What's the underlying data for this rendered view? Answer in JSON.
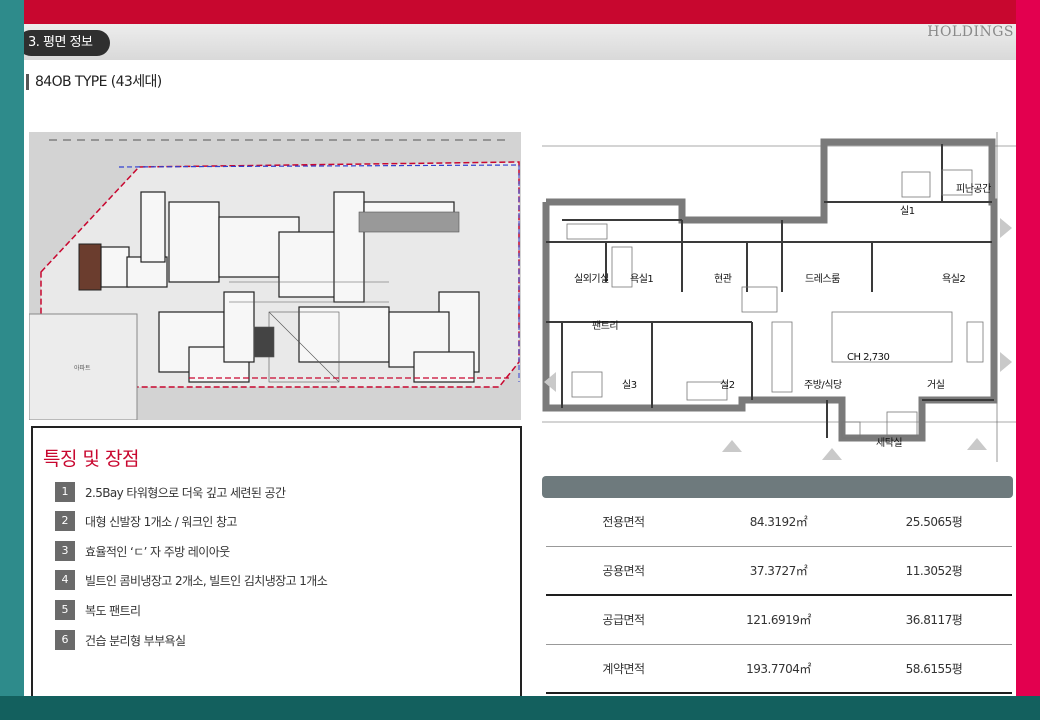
{
  "header": {
    "section_label": "3. 평면 정보",
    "brand": "HOLDINGS"
  },
  "type_title": "84OB TYPE (43세대)",
  "site_plan": {
    "building_label": "아파트"
  },
  "features": {
    "title": "특징 및 장점",
    "items": [
      {
        "num": "1",
        "text": "2.5Bay 타워형으로 더욱 깊고 세련된 공간"
      },
      {
        "num": "2",
        "text": "대형 신발장 1개소 / 워크인 창고"
      },
      {
        "num": "3",
        "text": "효율적인 ‘ㄷ’ 자 주방 레이아웃"
      },
      {
        "num": "4",
        "text": "빌트인 콤비냉장고 2개소, 빌트인 김치냉장고 1개소"
      },
      {
        "num": "5",
        "text": "복도 팬트리"
      },
      {
        "num": "6",
        "text": "건습 분리형 부부욕실"
      }
    ]
  },
  "floor_plan": {
    "rooms": {
      "room1": "실1",
      "evac": "피난공간",
      "outdoor_unit": "실외기실",
      "bath1": "욕실1",
      "entrance": "현관",
      "dress": "드레스룸",
      "bath2": "욕실2",
      "pantry": "팬트리",
      "room3": "실3",
      "room2": "실2",
      "kitchen": "주방/식당",
      "living": "거실",
      "laundry": "세탁실"
    },
    "ceiling_note": "CH 2,730"
  },
  "area_table": {
    "rows": [
      {
        "label": "전용면적",
        "sqm": "84.3192㎡",
        "pyeong": "25.5065평"
      },
      {
        "label": "공용면적",
        "sqm": "37.3727㎡",
        "pyeong": "11.3052평"
      },
      {
        "label": "공급면적",
        "sqm": "121.6919㎡",
        "pyeong": "36.8117평"
      },
      {
        "label": "계약면적",
        "sqm": "193.7704㎡",
        "pyeong": "58.6155평"
      }
    ]
  },
  "colors": {
    "frame_top": "#c8072f",
    "frame_left": "#2e8b8b",
    "frame_right": "#e3004f",
    "frame_bottom": "#13605e",
    "accent_red": "#c8072f",
    "table_header": "#6e7a7d"
  }
}
